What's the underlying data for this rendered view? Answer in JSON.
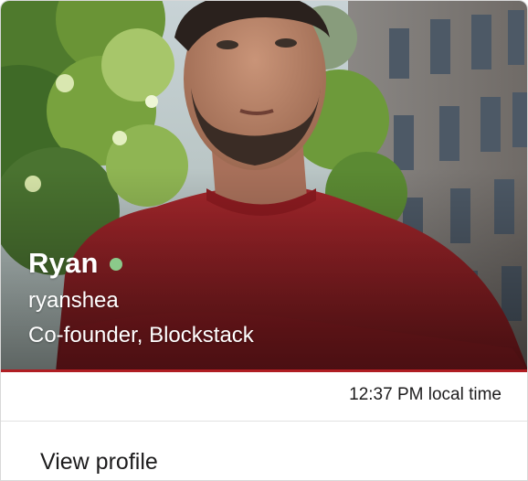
{
  "profile": {
    "name": "Ryan",
    "username": "ryanshea",
    "title": "Co-founder, Blockstack",
    "presence_status": "active",
    "presence_color": "#8bc98a",
    "local_time": "12:37 PM local time",
    "view_profile_label": "View profile"
  }
}
